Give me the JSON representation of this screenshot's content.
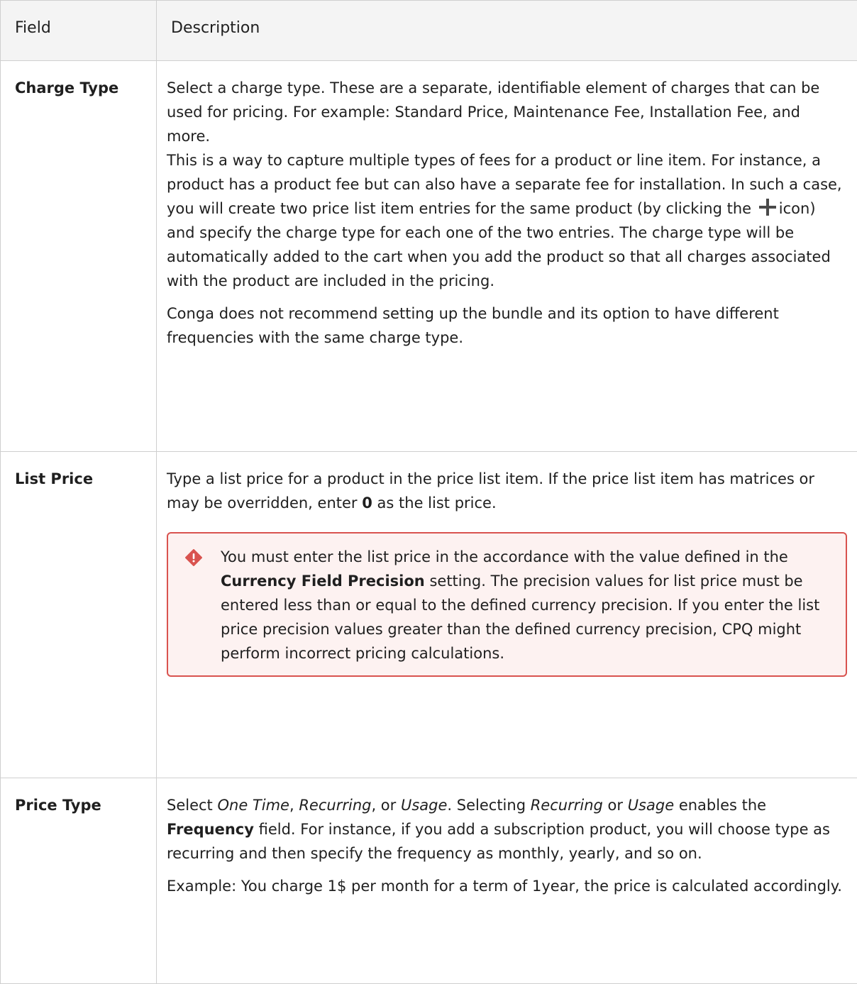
{
  "header": {
    "field": "Field",
    "description": "Description"
  },
  "rows": {
    "charge_type": {
      "name": "Charge Type",
      "p1": "Select a charge type. These are a separate, identifiable element of charges that can be used for pricing. For example: Standard Price, Maintenance Fee, Installation Fee, and more.",
      "p2_before": "This is a way to capture multiple types of fees for a product or line item. For instance, a product has a product fee but can also have a separate fee for installation. In such a case, you will create two price list item entries for the same product (by clicking the",
      "p2_after": "icon) and specify the charge type for each one of the two entries. The charge type will be automatically added to the cart when you add the product so that all charges associated with the product are included in the pricing.",
      "p3": "Conga does not recommend setting up the bundle and its option to have different frequencies with the same charge type."
    },
    "list_price": {
      "name": "List Price",
      "p1_before": "Type a list price for a product in the price list item. If the price list item has matrices or may be overridden, enter",
      "p1_bold": "0",
      "p1_after": "as the list price.",
      "warn_before": "You must enter the list price in the accordance with the value defined in the",
      "warn_bold": "Currency Field Precision",
      "warn_after": "setting. The precision values for list price must be entered less than or equal to the defined currency precision. If you enter the list price precision values greater than the defined currency precision, CPQ might perform incorrect pricing calculations."
    },
    "price_type": {
      "name": "Price Type",
      "t1": "Select",
      "i1": "One Time",
      "t2": ",",
      "i2": "Recurring",
      "t3": ", or",
      "i3": "Usage",
      "t4": ". Selecting",
      "i4": "Recurring",
      "t5": "or",
      "i5": "Usage",
      "t6": "enables the",
      "b1": "Frequency",
      "t7": "field. For instance, if you add a subscription product, you will choose type as recurring and then specify the frequency as monthly, yearly, and so on.",
      "p2": "Example: You charge 1$ per month for a term of 1year, the price is calculated accordingly."
    }
  },
  "icons": {
    "plus": "plus-icon",
    "warning": "warning-diamond-icon"
  },
  "colors": {
    "header_bg": "#f4f4f4",
    "warn_border": "#d9534f",
    "warn_bg": "#fdf2f1"
  }
}
